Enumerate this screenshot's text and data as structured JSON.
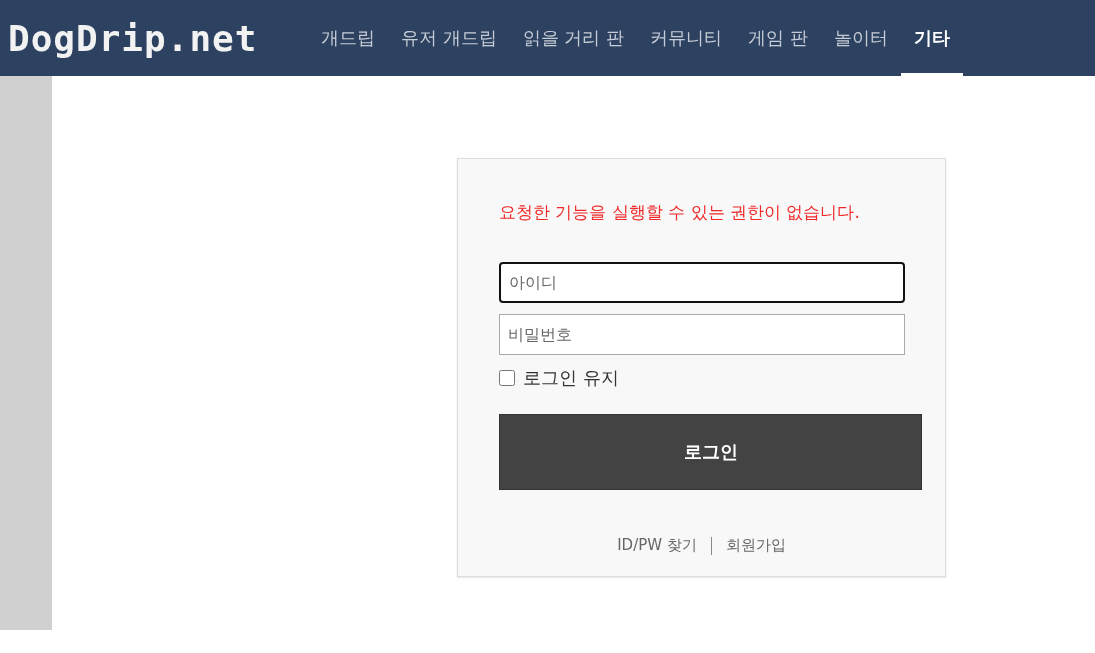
{
  "header": {
    "logo": "DogDrip.net",
    "nav": [
      {
        "label": "개드립",
        "selected": false
      },
      {
        "label": "유저 개드립",
        "selected": false
      },
      {
        "label": "읽을 거리 판",
        "selected": false
      },
      {
        "label": "커뮤니티",
        "selected": false
      },
      {
        "label": "게임 판",
        "selected": false
      },
      {
        "label": "놀이터",
        "selected": false
      },
      {
        "label": "기타",
        "selected": true
      }
    ]
  },
  "login": {
    "error": "요청한 기능을 실행할 수 있는 권한이 없습니다.",
    "fields": [
      {
        "placeholder": "아이디",
        "focused": true
      },
      {
        "placeholder": "비밀번호",
        "focused": false
      }
    ],
    "remember": {
      "label": "로그인 유지",
      "checked": false
    },
    "submit": "로그인",
    "links": [
      "ID/PW 찾기",
      "회원가입"
    ]
  }
}
